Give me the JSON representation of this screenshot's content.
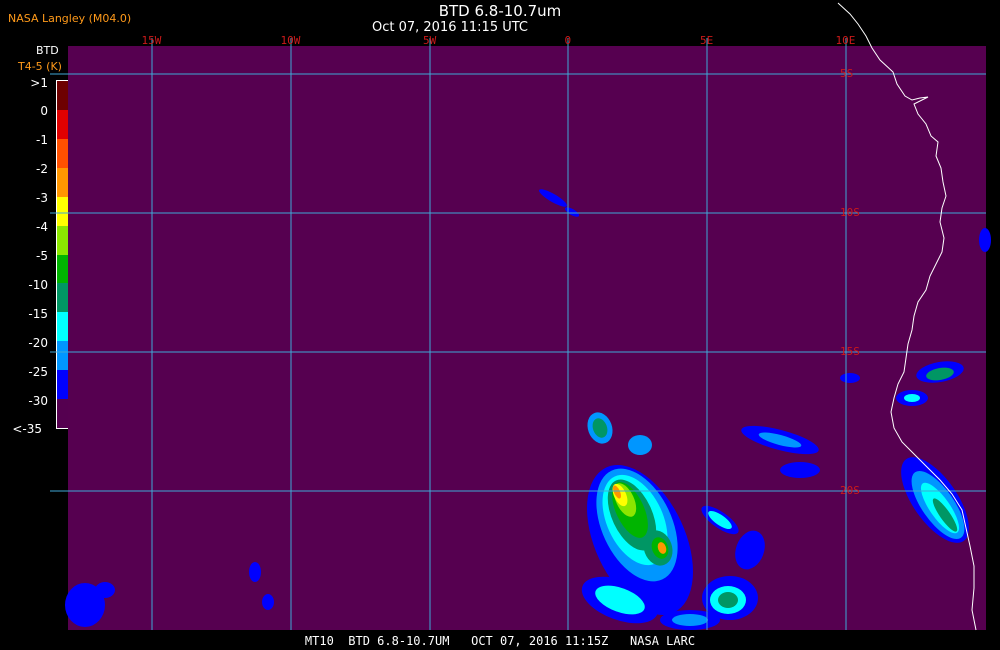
{
  "header": {
    "agency": "NASA Langley (M04.0)",
    "title": "BTD 6.8-10.7um",
    "subtitle": "Oct 07, 2016 11:15 UTC"
  },
  "legend": {
    "title": "BTD",
    "units": "T4-5 (K)",
    "ticks": [
      ">1",
      "0",
      "-1",
      "-2",
      "-3",
      "-4",
      "-5",
      "-10",
      "-15",
      "-20",
      "-25",
      "-30",
      "<-35"
    ],
    "colors": [
      "#6e0000",
      "#e00000",
      "#ff5000",
      "#ff9600",
      "#ffff00",
      "#8ce600",
      "#00b400",
      "#009664",
      "#00ffff",
      "#0096ff",
      "#0000ff",
      "#550050"
    ]
  },
  "grid": {
    "longitudes": [
      "15W",
      "10W",
      "5W",
      "0",
      "5E",
      "10E"
    ],
    "latitudes": [
      "5S",
      "10S",
      "15S",
      "20S"
    ],
    "line_color": "#3fa9d6"
  },
  "coast_color": "#ffffff",
  "footer": "MT10  BTD 6.8-10.7UM   OCT 07, 2016 11:15Z   NASA LARC",
  "colors": {
    "background": "#560050",
    "label_red": "#cc1a1a",
    "label_orange": "#ff9a1a"
  }
}
